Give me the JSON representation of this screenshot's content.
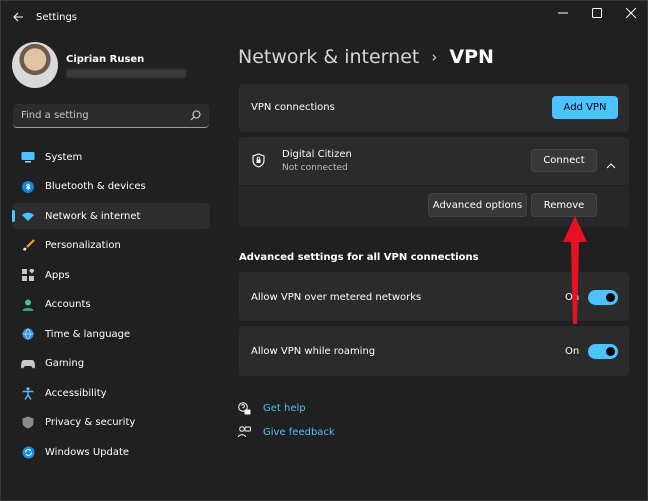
{
  "window": {
    "title": "Settings"
  },
  "profile": {
    "name": "Ciprian Rusen"
  },
  "search": {
    "placeholder": "Find a setting"
  },
  "sidebar": {
    "items": [
      {
        "label": "System",
        "icon": "monitor-icon"
      },
      {
        "label": "Bluetooth & devices",
        "icon": "bluetooth-icon"
      },
      {
        "label": "Network & internet",
        "icon": "wifi-icon",
        "active": true
      },
      {
        "label": "Personalization",
        "icon": "brush-icon"
      },
      {
        "label": "Apps",
        "icon": "apps-icon"
      },
      {
        "label": "Accounts",
        "icon": "person-icon"
      },
      {
        "label": "Time & language",
        "icon": "globe-clock-icon"
      },
      {
        "label": "Gaming",
        "icon": "gamepad-icon"
      },
      {
        "label": "Accessibility",
        "icon": "accessibility-icon"
      },
      {
        "label": "Privacy & security",
        "icon": "shield-icon"
      },
      {
        "label": "Windows Update",
        "icon": "update-icon"
      }
    ]
  },
  "breadcrumb": {
    "parent": "Network & internet",
    "separator": "›",
    "current": "VPN"
  },
  "vpn": {
    "connections_label": "VPN connections",
    "add_button": "Add VPN",
    "connection": {
      "name": "Digital Citizen",
      "status": "Not connected",
      "connect_button": "Connect",
      "advanced_button": "Advanced options",
      "remove_button": "Remove"
    }
  },
  "advanced": {
    "heading": "Advanced settings for all VPN connections",
    "metered": {
      "label": "Allow VPN over metered networks",
      "state": "On"
    },
    "roaming": {
      "label": "Allow VPN while roaming",
      "state": "On"
    }
  },
  "links": {
    "help": "Get help",
    "feedback": "Give feedback"
  },
  "colors": {
    "accent": "#4cc2ff",
    "background": "#202020",
    "card": "#2b2b2b",
    "annotation_arrow": "#e81123"
  }
}
